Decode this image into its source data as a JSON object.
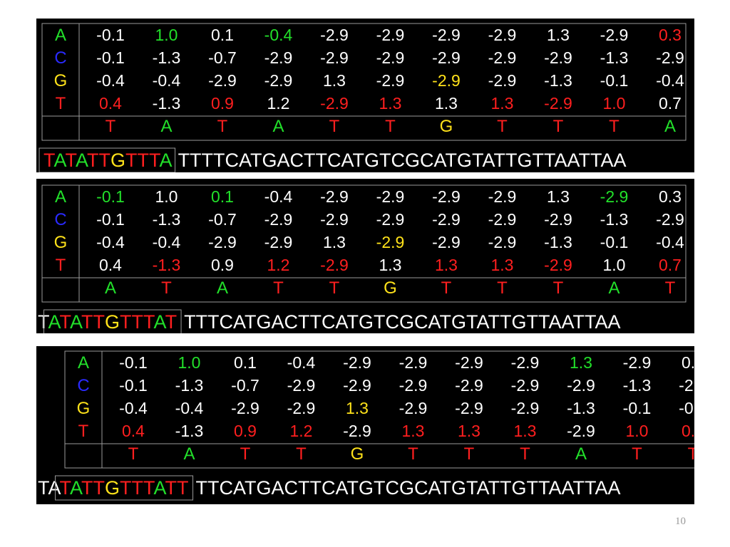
{
  "colors": {
    "white": "#ffffff",
    "green": "#22e02a",
    "red": "#ff1f1f",
    "yellow": "#ffe21a",
    "blue": "#2a2aff",
    "border": "#9a9a9a"
  },
  "row_labels": [
    {
      "text": "A",
      "color": "#22e02a"
    },
    {
      "text": "C",
      "color": "#2a2aff"
    },
    {
      "text": "G",
      "color": "#ffe21a"
    },
    {
      "text": "T",
      "color": "#ff1f1f"
    }
  ],
  "matrix": [
    [
      "-0.1",
      "1.0",
      "0.1",
      "-0.4",
      "-2.9",
      "-2.9",
      "-2.9",
      "-2.9",
      "1.3",
      "-2.9",
      "0.3"
    ],
    [
      "-0.1",
      "-1.3",
      "-0.7",
      "-2.9",
      "-2.9",
      "-2.9",
      "-2.9",
      "-2.9",
      "-2.9",
      "-1.3",
      "-2.9"
    ],
    [
      "-0.4",
      "-0.4",
      "-2.9",
      "-2.9",
      "1.3",
      "-2.9",
      "-2.9",
      "-2.9",
      "-1.3",
      "-0.1",
      "-0.4"
    ],
    [
      "0.4",
      "-1.3",
      "0.9",
      "1.2",
      "-2.9",
      "1.3",
      "1.3",
      "1.3",
      "-2.9",
      "1.0",
      "0.7"
    ]
  ],
  "panels": [
    {
      "highlights": [
        {
          "row": 0,
          "col": 1,
          "color": "green"
        },
        {
          "row": 0,
          "col": 3,
          "color": "green"
        },
        {
          "row": 0,
          "col": 10,
          "color": "red"
        },
        {
          "row": 2,
          "col": 6,
          "color": "yellow"
        },
        {
          "row": 3,
          "col": 0,
          "color": "red"
        },
        {
          "row": 3,
          "col": 2,
          "color": "red"
        },
        {
          "row": 3,
          "col": 4,
          "color": "red"
        },
        {
          "row": 3,
          "col": 5,
          "color": "red"
        },
        {
          "row": 3,
          "col": 7,
          "color": "red"
        },
        {
          "row": 3,
          "col": 8,
          "color": "red"
        },
        {
          "row": 3,
          "col": 9,
          "color": "red"
        }
      ],
      "window": [
        "T",
        "A",
        "T",
        "A",
        "T",
        "T",
        "G",
        "T",
        "T",
        "T",
        "A"
      ],
      "prefix": "",
      "suffix": "TTTTCATGACTTCATGTCGCATGTATTGTTAATTAA"
    },
    {
      "highlights": [
        {
          "row": 0,
          "col": 0,
          "color": "green"
        },
        {
          "row": 0,
          "col": 2,
          "color": "green"
        },
        {
          "row": 0,
          "col": 9,
          "color": "green"
        },
        {
          "row": 2,
          "col": 5,
          "color": "yellow"
        },
        {
          "row": 3,
          "col": 1,
          "color": "red"
        },
        {
          "row": 3,
          "col": 3,
          "color": "red"
        },
        {
          "row": 3,
          "col": 4,
          "color": "red"
        },
        {
          "row": 3,
          "col": 6,
          "color": "red"
        },
        {
          "row": 3,
          "col": 7,
          "color": "red"
        },
        {
          "row": 3,
          "col": 8,
          "color": "red"
        },
        {
          "row": 3,
          "col": 10,
          "color": "red"
        }
      ],
      "window": [
        "A",
        "T",
        "A",
        "T",
        "T",
        "G",
        "T",
        "T",
        "T",
        "A",
        "T"
      ],
      "prefix": "T",
      "suffix": "TTTCATGACTTCATGTCGCATGTATTGTTAATTAA"
    },
    {
      "highlights": [
        {
          "row": 0,
          "col": 1,
          "color": "green"
        },
        {
          "row": 0,
          "col": 8,
          "color": "green"
        },
        {
          "row": 2,
          "col": 4,
          "color": "yellow"
        },
        {
          "row": 3,
          "col": 0,
          "color": "red"
        },
        {
          "row": 3,
          "col": 2,
          "color": "red"
        },
        {
          "row": 3,
          "col": 3,
          "color": "red"
        },
        {
          "row": 3,
          "col": 5,
          "color": "red"
        },
        {
          "row": 3,
          "col": 6,
          "color": "red"
        },
        {
          "row": 3,
          "col": 7,
          "color": "red"
        },
        {
          "row": 3,
          "col": 9,
          "color": "red"
        },
        {
          "row": 3,
          "col": 10,
          "color": "red"
        }
      ],
      "window": [
        "T",
        "A",
        "T",
        "T",
        "G",
        "T",
        "T",
        "T",
        "A",
        "T",
        "T"
      ],
      "prefix": "TA",
      "suffix": "TTCATGACTTCATGTCGCATGTATTGTTAATTAA"
    }
  ],
  "slide_number": "10"
}
